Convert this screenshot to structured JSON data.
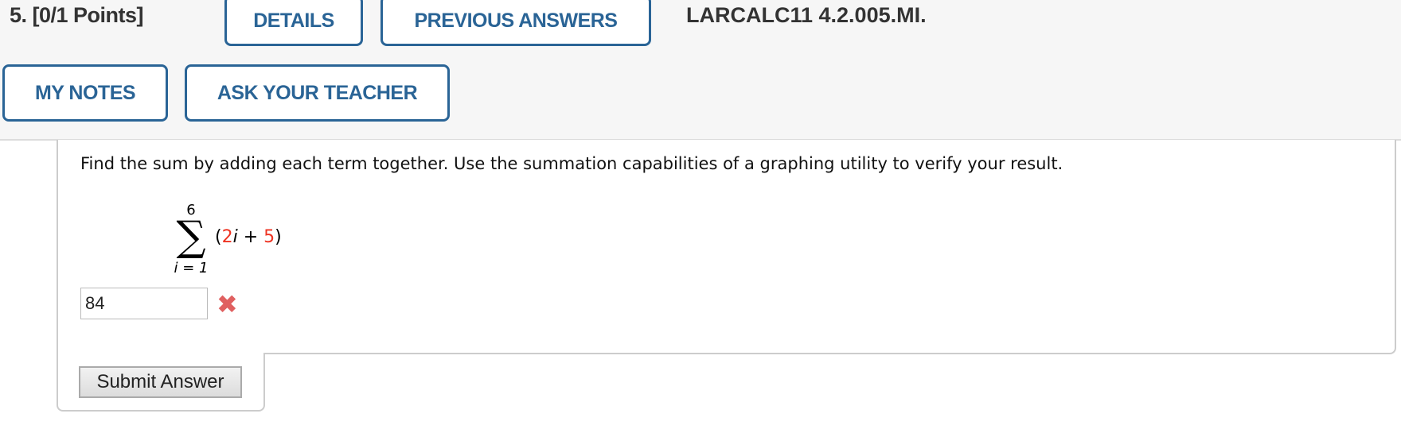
{
  "header": {
    "points": "5.  [0/1 Points]",
    "details_label": "DETAILS",
    "previous_answers_label": "PREVIOUS ANSWERS",
    "problem_id": "LARCALC11 4.2.005.MI.",
    "my_notes_label": "MY NOTES",
    "ask_teacher_label": "ASK YOUR TEACHER",
    "accent_color": "#2a6496"
  },
  "question": {
    "text": "Find the sum by adding each term together. Use the summation capabilities of a graphing utility to verify your result.",
    "upper_limit": "6",
    "sigma": "∑",
    "lower_limit": "i = 1",
    "expr_open": "(",
    "coef": "2",
    "var": "i",
    "plus": " + ",
    "const": "5",
    "expr_close": ")"
  },
  "answer": {
    "value": "84",
    "status_icon": "incorrect-x-icon",
    "status_color": "#e06060"
  },
  "submit_label": "Submit Answer"
}
